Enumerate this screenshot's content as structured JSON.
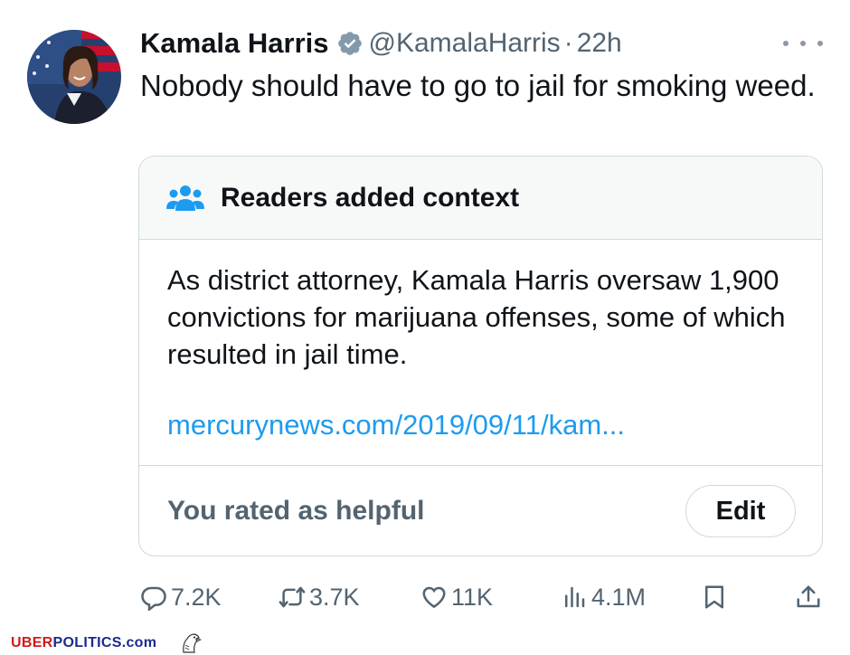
{
  "tweet": {
    "author_name": "Kamala Harris",
    "handle": "@KamalaHarris",
    "separator": "·",
    "time": "22h",
    "text": "Nobody should have to go to jail for smoking weed."
  },
  "community_note": {
    "title": "Readers added context",
    "body": "As district attorney, Kamala Harris oversaw 1,900 convictions for marijuana offenses, some of which resulted in jail time.",
    "link": "mercurynews.com/2019/09/11/kam...",
    "rating_status": "You rated as helpful",
    "edit_label": "Edit"
  },
  "metrics": {
    "replies": "7.2K",
    "reposts": "3.7K",
    "likes": "11K",
    "views": "4.1M"
  },
  "watermark": {
    "brand_part1": "UBER",
    "brand_part2": "POLITICS",
    "brand_part3": ".com"
  },
  "colors": {
    "verified_badge": "#829aab",
    "link": "#1d9bf0",
    "note_icon": "#1d9bf0",
    "secondary_text": "#536471",
    "border": "#cfd9de"
  },
  "icons": {
    "verified": "verified-badge-icon",
    "more": "more-icon",
    "note": "people-icon",
    "reply": "reply-icon",
    "repost": "repost-icon",
    "like": "heart-icon",
    "views": "analytics-icon",
    "bookmark": "bookmark-icon",
    "share": "share-icon"
  }
}
